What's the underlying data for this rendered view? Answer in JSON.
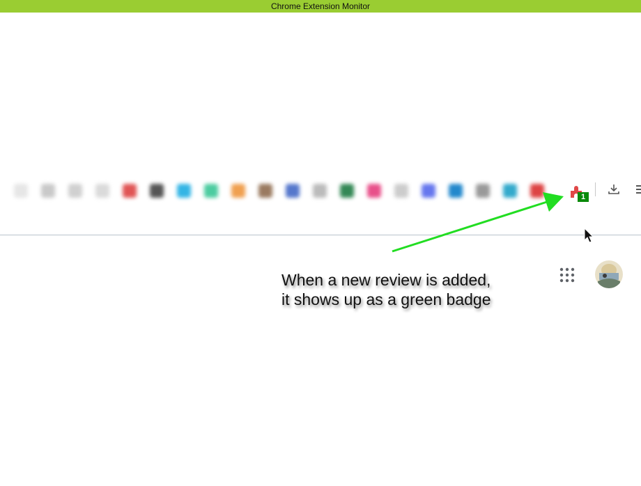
{
  "window": {
    "title": "Chrome Extension Monitor"
  },
  "toolbar": {
    "blurred_icon_colors": [
      "#e6e6e6",
      "#c9c9c9",
      "#d0d0d0",
      "#dadada",
      "#e05555",
      "#555555",
      "#33b5e5",
      "#4ccca0",
      "#f0a050",
      "#9a7a60",
      "#5577cc",
      "#bbbbbb",
      "#338855",
      "#e8508a",
      "#cccccc",
      "#6677ee",
      "#2288cc",
      "#999999",
      "#33aacc",
      "#dd4444"
    ],
    "extension_icon": "puzzle-extension-icon",
    "badge_count": "1",
    "badge_color": "#0a8a0a",
    "download_icon": "download-icon",
    "menu_icon": "menu-icon"
  },
  "page": {
    "apps_icon": "apps-grid-icon",
    "avatar": "user-avatar"
  },
  "annotation": {
    "line1": "When a new review is added,",
    "line2": "it shows up as a green badge",
    "arrow_color": "#22dd22"
  }
}
